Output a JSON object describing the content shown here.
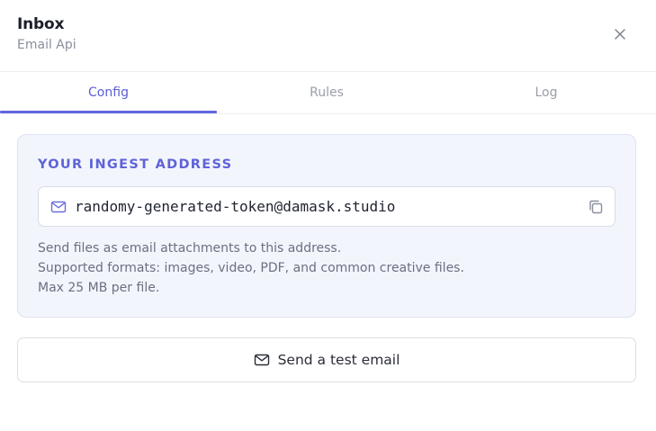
{
  "header": {
    "title": "Inbox",
    "subtitle": "Email Api",
    "close_icon": "close-icon"
  },
  "tabs": [
    {
      "label": "Config",
      "active": true
    },
    {
      "label": "Rules",
      "active": false
    },
    {
      "label": "Log",
      "active": false
    }
  ],
  "ingest": {
    "heading": "YOUR INGEST ADDRESS",
    "address": "randomy-generated-token@damask.studio",
    "address_icon": "mail-icon",
    "copy_icon": "copy-icon",
    "help_lines": [
      "Send files as email attachments to this address.",
      "Supported formats: images, video, PDF, and common creative files.",
      "Max 25 MB per file."
    ]
  },
  "test_button": {
    "label": "Send a test email",
    "icon": "mail-icon"
  },
  "colors": {
    "accent": "#6366e0",
    "card_bg": "#f3f5fd",
    "muted_text": "#6b7080"
  }
}
